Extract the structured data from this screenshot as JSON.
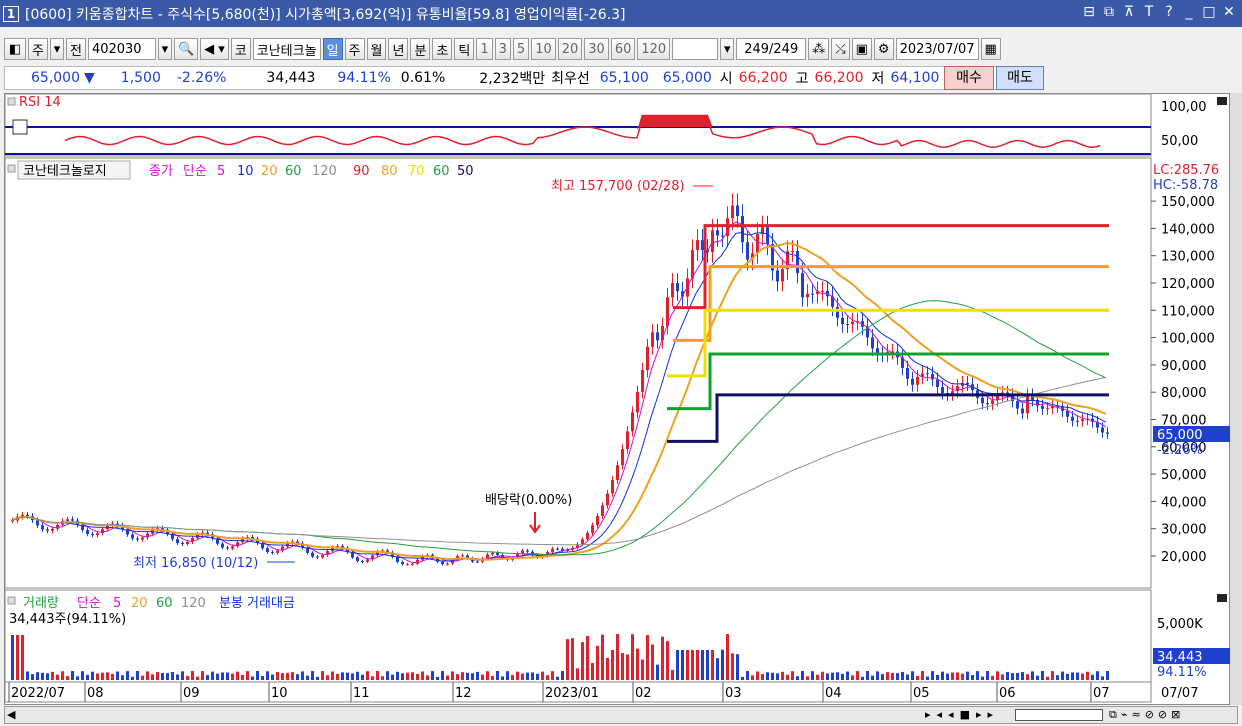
{
  "window": {
    "number": "1",
    "title": "[0600] 키움종합차트 - 주식수[5,680(천)] 시가총액[3,692(억)] 유통비율[59.8] 영업이익률[-26.3]"
  },
  "toolbar": {
    "type_sel": "주",
    "prev": "전",
    "code": "402030",
    "market": "코",
    "stock_name": "코난테크놀",
    "periods": [
      "일",
      "주",
      "월",
      "년",
      "분",
      "초",
      "틱"
    ],
    "active_period": "일",
    "intervals": [
      "1",
      "3",
      "5",
      "10",
      "20",
      "30",
      "60",
      "120"
    ],
    "count": "249",
    "total": "/249",
    "date": "2023/07/07"
  },
  "quote": {
    "price": "65,000",
    "arrow": "▼",
    "change": "1,500",
    "change_pct": "-2.26%",
    "volume": "34,443",
    "vol_ratio": "94.11%",
    "turnover": "0.61%",
    "amount": "2,232백만",
    "pref_label": "최우선",
    "ask": "65,100",
    "bid": "65,000",
    "open_label": "시",
    "open": "66,200",
    "high_label": "고",
    "high": "66,200",
    "low_label": "저",
    "low": "64,100",
    "buy": "매수",
    "sell": "매도"
  },
  "rsi": {
    "title": "RSI 14",
    "levels": [
      "100,00",
      "50,00"
    ]
  },
  "main_legend": {
    "name": "코난테크놀로지",
    "close_label": "종가",
    "ma_type": "단순",
    "ma_periods": [
      "5",
      "10",
      "20",
      "60",
      "120"
    ],
    "lines": [
      "90",
      "80",
      "70",
      "60",
      "50"
    ]
  },
  "right_labels": {
    "lc": "LC:285.76",
    "hc": "HC:-58.78",
    "price": "65,000",
    "pct": "-2.26%"
  },
  "price_axis": [
    "150,000",
    "140,000",
    "130,000",
    "120,000",
    "110,000",
    "100,000",
    "90,000",
    "80,000",
    "70,000",
    "60,000",
    "50,000",
    "40,000",
    "30,000",
    "20,000"
  ],
  "annotations": {
    "high": "최고 157,700 (02/28)",
    "low": "최저 16,850 (10/12)",
    "dividend": "배당락(0.00%)"
  },
  "volume": {
    "title": "거래량",
    "ma_type": "단순",
    "ma": [
      "5",
      "20",
      "60",
      "120"
    ],
    "extra": "분봉 거래대금",
    "value_label": "34,443주(94.11%)",
    "axis": "5,000K",
    "last": "34,443",
    "last_pct": "94.11%"
  },
  "xaxis": [
    "2022/07",
    "08",
    "09",
    "10",
    "11",
    "12",
    "2023/01",
    "02",
    "03",
    "04",
    "05",
    "06",
    "07"
  ],
  "xaxis_right": "07/07",
  "colors": {
    "up": "#e0202c",
    "down": "#1f3fcf",
    "ma5": "#d010d0",
    "ma10": "#1030e0",
    "ma20": "#f0a020",
    "ma60": "#20a040",
    "ma120": "#909090"
  }
}
